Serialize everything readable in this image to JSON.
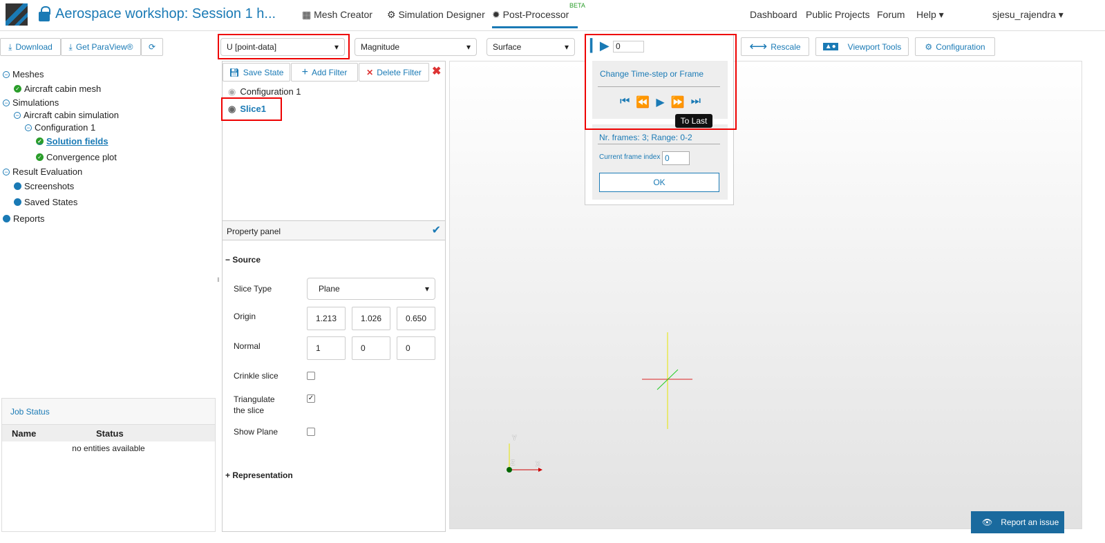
{
  "header": {
    "title": "Aerospace workshop: Session 1 h...",
    "nav": [
      {
        "label": "Mesh Creator"
      },
      {
        "label": "Simulation Designer"
      },
      {
        "label": "Post-Processor",
        "badge": "BETA"
      }
    ],
    "right": [
      "Dashboard",
      "Public Projects",
      "Forum",
      "Help"
    ],
    "user": "sjesu_rajendra"
  },
  "toolbar": {
    "download": "Download",
    "paraview": "Get ParaView®",
    "field": "U [point-data]",
    "component": "Magnitude",
    "representation": "Surface",
    "frame": "0",
    "rescale": "Rescale",
    "viewport_tools": "Viewport Tools",
    "configuration": "Configuration"
  },
  "sidebar": {
    "meshes": "Meshes",
    "mesh1": "Aircraft cabin mesh",
    "simulations": "Simulations",
    "sim1": "Aircraft cabin simulation",
    "config1": "Configuration 1",
    "solution": " Solution fields",
    "convergence": "Convergence plot",
    "result": "Result Evaluation",
    "screenshots": "Screenshots",
    "saved": "Saved States",
    "reports": "Reports"
  },
  "job": {
    "title": "Job Status",
    "col_name": "Name",
    "col_status": "Status",
    "empty": "no entities available"
  },
  "pipeline": {
    "save": "Save State",
    "add": "Add Filter",
    "delete": "Delete Filter",
    "items": [
      "Configuration 1",
      "Slice1"
    ]
  },
  "property": {
    "title": "Property panel",
    "source": "Source",
    "slice_type_label": "Slice Type",
    "slice_type": "Plane",
    "origin_label": "Origin",
    "origin": [
      "1.213",
      "1.026",
      "0.650"
    ],
    "normal_label": "Normal",
    "normal": [
      "1",
      "0",
      "0"
    ],
    "crinkle": "Crinkle slice",
    "triangulate": "Triangulate the slice",
    "show_plane": "Show Plane",
    "representation": "Representation"
  },
  "popup": {
    "title": "Change Time-step or Frame",
    "tooltip": "To Last",
    "frames": "Nr. frames:  3; Range: 0-2",
    "index_label": "Current frame index",
    "index": "0",
    "ok": "OK"
  },
  "report": "Report an issue",
  "axes": {
    "y": "Y",
    "x": "X",
    "z": "Z"
  }
}
